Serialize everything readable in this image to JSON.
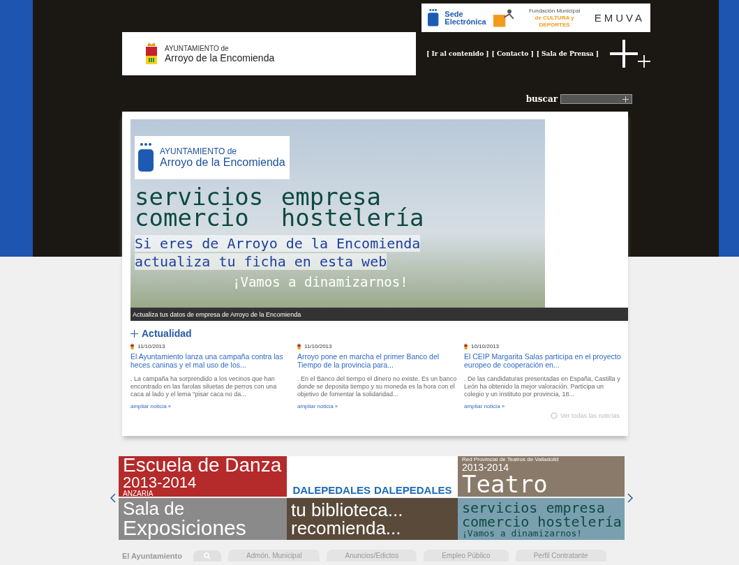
{
  "top_logos": {
    "sede": {
      "line1": "Sede",
      "line2": "Electrónica"
    },
    "fundacion": {
      "line1": "Fundación Municipal",
      "line2": "de CULTURA y DEPORTES"
    },
    "emuva": "EMUVA"
  },
  "logo": {
    "line1": "AYUNTAMIENTO de",
    "line2": "Arroyo de la Encomienda"
  },
  "links": [
    "[ Ir al contenido ]",
    "[ Contacto ]",
    "[ Sala de Prensa ]"
  ],
  "search": {
    "label": "buscar"
  },
  "featured": {
    "logo_line1": "AYUNTAMIENTO de",
    "logo_line2": "Arroyo de la Encomienda",
    "words": [
      "servicios",
      "empresa",
      "comercio",
      "hostelería"
    ],
    "line1": "Si eres de Arroyo de la Encomienda",
    "line2": "actualiza tu ficha en esta web",
    "slogan": "¡Vamos a dinamizarnos!",
    "caption": "Actualiza tus datos de empresa de Arroyo de la Encomienda"
  },
  "news": {
    "title": "Actualidad",
    "items": [
      {
        "date": "11/10/2013",
        "headline": "El Ayuntamiento lanza una campaña contra las heces caninas y el mal uso de los...",
        "summary": ". La campaña ha sorprendido a los vecinos que han encontrado en las farolas siluetas de perros con una caca al lado y el lema \"pisar caca no da...",
        "link": "ampliar noticia »"
      },
      {
        "date": "11/10/2013",
        "headline": "Arroyo pone en marcha el primer Banco del Tiempo de la provincia para...",
        "summary": ". En el Banco del tiempo el dinero no existe. Es un banco donde se deposita tiempo y su moneda es la hora con el objetivo de fomentar la solidaridad...",
        "link": "ampliar noticia »"
      },
      {
        "date": "10/10/2013",
        "headline": "El CEIP Margarita Salas participa en el proyecto europeo de cooperación en...",
        "summary": ". De las candidaturas presentadas en España, Castilla y León ha obtenido la mejor valoración. Participa un colegio y un instituto por provincia, 18...",
        "link": "ampliar noticia »"
      }
    ],
    "more": "Ver todas las noticias"
  },
  "tiles": [
    {
      "kind": "danza",
      "lines": [
        "Escuela de Danza",
        "2013-2014",
        "ANZARIA"
      ]
    },
    {
      "kind": "pedales",
      "lines": [
        "DALEPEDALES",
        "DALEPEDALES"
      ]
    },
    {
      "kind": "teatro",
      "lines": [
        "Red Provincial de Teatros de Valladolid",
        "2013-2014",
        "Teatro"
      ]
    },
    {
      "kind": "sala",
      "lines": [
        "Sala de",
        "Exposiciones"
      ]
    },
    {
      "kind": "biblioteca",
      "lines": [
        "tu biblioteca...",
        "recomienda..."
      ]
    },
    {
      "kind": "servicios",
      "lines": [
        "servicios empresa",
        "comercio hostelería",
        "¡Vamos a dinamizarnos!"
      ]
    }
  ],
  "nav": {
    "title": "El Ayuntamiento",
    "tabs": [
      "Admón. Municipal",
      "Anuncios/Edictos",
      "Empleo Público",
      "Perfil Contratante"
    ]
  }
}
